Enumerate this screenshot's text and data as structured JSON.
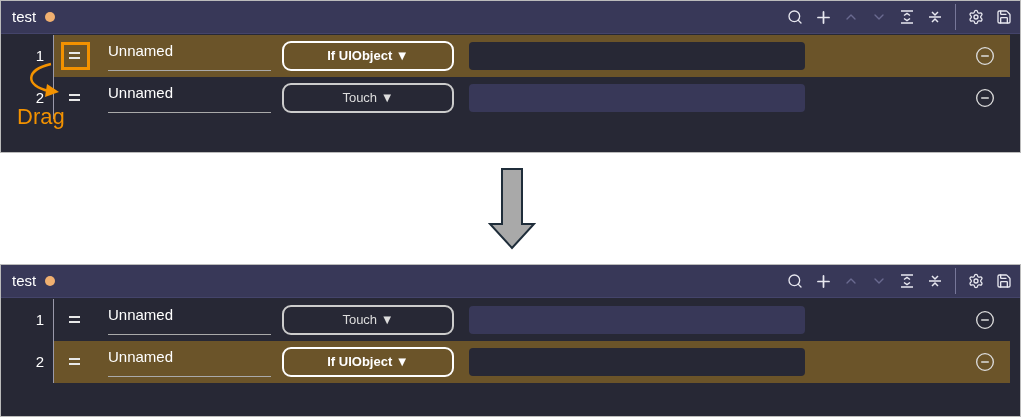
{
  "panels": [
    {
      "title": "test",
      "modified": true,
      "toolbar": [
        {
          "kind": "search",
          "disabled": false
        },
        {
          "kind": "add",
          "disabled": false
        },
        {
          "kind": "up",
          "disabled": true
        },
        {
          "kind": "down",
          "disabled": true
        },
        {
          "kind": "expand",
          "disabled": false
        },
        {
          "kind": "collapse",
          "disabled": false
        },
        {
          "kind": "settings",
          "disabled": false
        },
        {
          "kind": "save",
          "disabled": false
        }
      ],
      "rows": [
        {
          "number": "1",
          "name": "Unnamed",
          "action": "If UIObject ▼",
          "selected": true
        },
        {
          "number": "2",
          "name": "Unnamed",
          "action": "Touch ▼",
          "selected": false
        }
      ],
      "drag_hint": {
        "label": "Drag"
      }
    },
    {
      "title": "test",
      "modified": true,
      "toolbar": [
        {
          "kind": "search",
          "disabled": false
        },
        {
          "kind": "add",
          "disabled": false
        },
        {
          "kind": "up",
          "disabled": true
        },
        {
          "kind": "down",
          "disabled": true
        },
        {
          "kind": "expand",
          "disabled": false
        },
        {
          "kind": "collapse",
          "disabled": false
        },
        {
          "kind": "settings",
          "disabled": false
        },
        {
          "kind": "save",
          "disabled": false
        }
      ],
      "rows": [
        {
          "number": "1",
          "name": "Unnamed",
          "action": "Touch ▼",
          "selected": false
        },
        {
          "number": "2",
          "name": "Unnamed",
          "action": "If UIObject ▼",
          "selected": true
        }
      ]
    }
  ]
}
